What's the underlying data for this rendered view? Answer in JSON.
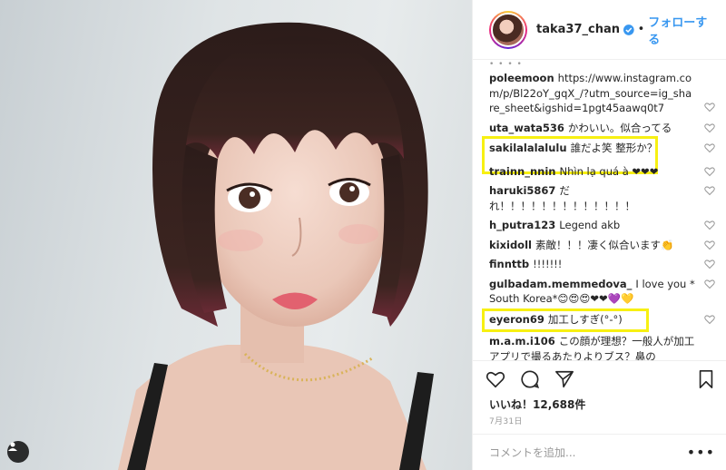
{
  "post": {
    "username": "taka37_chan",
    "separator": "•",
    "follow_label": "フォローする",
    "likes_label": "いいね！",
    "likes_count": "12,688件",
    "date": "7月31日",
    "comment_placeholder": "コメントを追加...",
    "more_dots": "• • • •"
  },
  "comments": [
    {
      "user": "poleemoon",
      "text": "https://www.instagram.com/p/Bl22oY_gqX_/?utm_source=ig_share_sheet&igshid=1pgt45aawq0t7"
    },
    {
      "user": "uta_wata536",
      "text": "かわいい。似合ってる"
    },
    {
      "user": "sakilalalalulu",
      "text": "誰だよ笑 整形か？"
    },
    {
      "user": "trainn_nnin",
      "text": "Nhìn lạ quá à ❤❤❤"
    },
    {
      "user": "haruki5867",
      "text": "だれ！！！！！！！！！！！！！"
    },
    {
      "user": "h_putra123",
      "text": "Legend akb"
    },
    {
      "user": "kixidoll",
      "text": "素敵！！！凄く似合います👏"
    },
    {
      "user": "finnttb",
      "text": "!!!!!!!"
    },
    {
      "user": "gulbadam.memmedova_",
      "text": "I love you *South Korea*😊😍😍❤❤💜💛"
    },
    {
      "user": "eyeron69",
      "text": "加工しすぎ(°-°)"
    },
    {
      "user": "m.a.m.i106",
      "text": "この顔が理想？一般人が加工アプリで撮るあたりよりブス？鼻の"
    }
  ],
  "colors": {
    "follow": "#3897f0",
    "highlight": "#f7f012",
    "verified": "#3897f0"
  }
}
